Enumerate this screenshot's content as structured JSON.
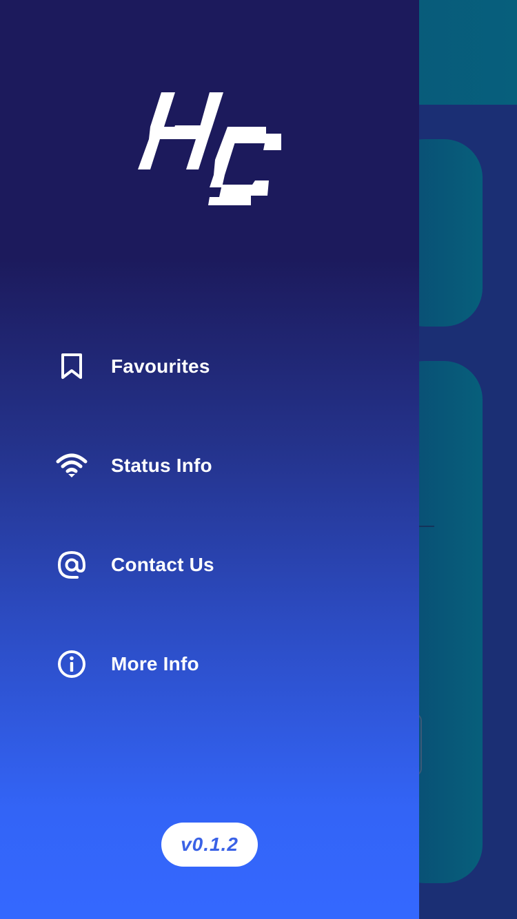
{
  "drawer": {
    "logo_name": "HC logo",
    "menu": [
      {
        "label": "Favourites",
        "icon": "bookmark-icon"
      },
      {
        "label": "Status Info",
        "icon": "wifi-icon"
      },
      {
        "label": "Contact Us",
        "icon": "at-sign-icon"
      },
      {
        "label": "More Info",
        "icon": "info-icon"
      }
    ],
    "version": "v0.1.2"
  },
  "colors": {
    "drawer_top": "#1c1a5c",
    "drawer_bottom": "#3468ff",
    "background_app": "#1b2f74",
    "background_card": "#075f7b",
    "version_text": "#3a62e6"
  }
}
